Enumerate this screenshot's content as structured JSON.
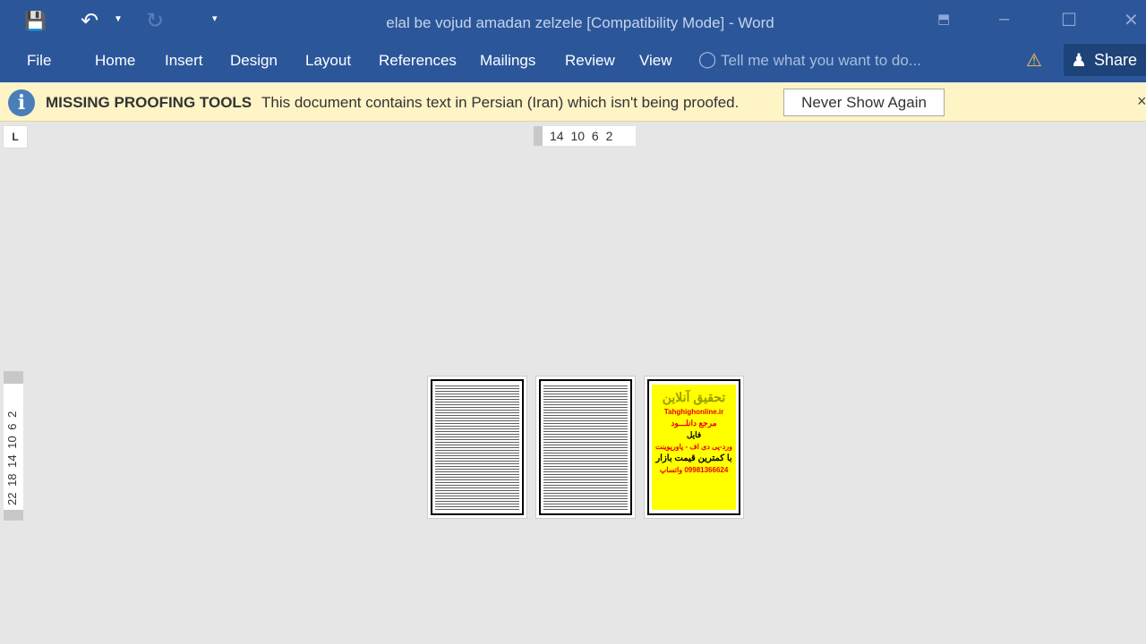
{
  "window": {
    "title": "elal be vojud amadan zelzele [Compatibility Mode] - Word"
  },
  "qat": {
    "save_icon": "save-icon",
    "undo_icon": "undo-icon",
    "redo_icon": "redo-icon",
    "customize_icon": "caret-down-icon"
  },
  "ribbon": {
    "tabs": [
      "File",
      "Home",
      "Insert",
      "Design",
      "Layout",
      "References",
      "Mailings",
      "Review",
      "View"
    ],
    "tell_me": "Tell me what you want to do...",
    "share": "Share"
  },
  "infobar": {
    "title": "MISSING PROOFING TOOLS",
    "message": "This document contains text in Persian (Iran) which isn't being proofed.",
    "button": "Never Show Again",
    "close": "×"
  },
  "ruler": {
    "tab_selector": "L",
    "horizontal": "14 10 6 2",
    "vertical": "22 18 14 10 6 2"
  },
  "ad_page": {
    "lines": [
      "تحقیق آنلاین",
      "Tahghighonline.ir",
      "مرجع دانلـــود",
      "فایل",
      "ورد-پی دی اف - پاورپوینت",
      "با کمترین قیمت بازار",
      "09981366624 واتساپ"
    ]
  },
  "colors": {
    "ribbon": "#2b579a",
    "infobar": "#fff4c6",
    "canvas": "#e6e6e6"
  }
}
